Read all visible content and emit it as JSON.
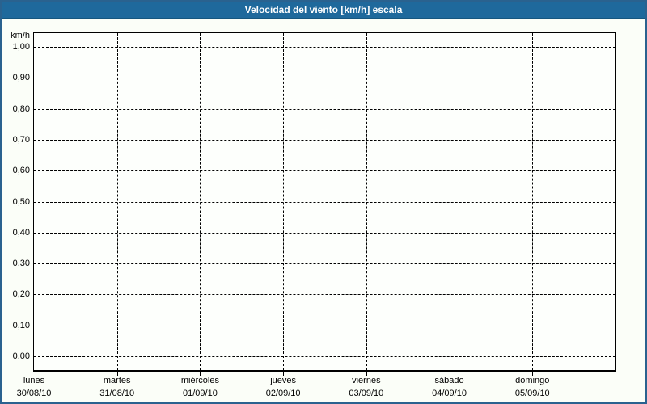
{
  "window": {
    "title": "Velocidad del viento [km/h] escala"
  },
  "colors": {
    "title_bar": "#1F699C",
    "title_text": "#FFFFFF",
    "window_border": "#2A628F",
    "background": "#FBFEF8",
    "plot_background": "#FDFFFC",
    "plot_border": "#000000",
    "gridline": "#000000",
    "label_text": "#000000"
  },
  "chart_data": {
    "type": "line",
    "title": "Velocidad del viento [km/h] escala",
    "ylabel": "km/h",
    "xlabel": "",
    "ylim": [
      0,
      1
    ],
    "y_tick_step": 0.1,
    "y_tick_labels": [
      "1,00",
      "0,90",
      "0,80",
      "0,70",
      "0,60",
      "0,50",
      "0,40",
      "0,30",
      "0,20",
      "0,10",
      "0,00"
    ],
    "x_tick_labels": [
      {
        "day": "lunes",
        "date": "30/08/10"
      },
      {
        "day": "martes",
        "date": "31/08/10"
      },
      {
        "day": "miércoles",
        "date": "01/09/10"
      },
      {
        "day": "jueves",
        "date": "02/09/10"
      },
      {
        "day": "viernes",
        "date": "03/09/10"
      },
      {
        "day": "sábado",
        "date": "04/09/10"
      },
      {
        "day": "domingo",
        "date": "05/09/10"
      }
    ],
    "series": [],
    "grid": {
      "horizontal": "dashed",
      "vertical": "dashed"
    },
    "legend_position": "none"
  }
}
